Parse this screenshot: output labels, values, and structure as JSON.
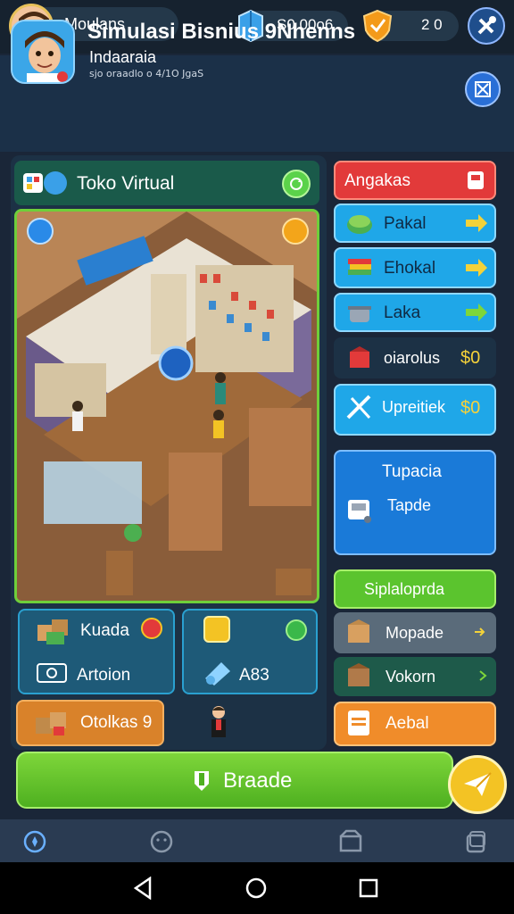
{
  "topbar": {
    "username": "Moulans",
    "coins": "S0 00o6",
    "gems": "2 0"
  },
  "header": {
    "title": "Simulasi Bisnius 9Nhenns",
    "subtitle": "Indaaraia",
    "meta": "sjo oraadlo o 4/1O JgaS"
  },
  "store": {
    "title": "Toko Virtual"
  },
  "tiles": {
    "kuada": "Kuada",
    "artoion": "Artoion",
    "a83": "A83",
    "otolkas": "Otolkas 9"
  },
  "menu": {
    "angakas": "Angakas",
    "pakal": "Pakal",
    "ehokal": "Ehokal",
    "laka": "Laka",
    "oiarolus": "oiarolus",
    "oiarolus_value": "$0",
    "upreitiek": "Upreitiek",
    "upreitiek_value": "$0",
    "tupacia": "Tupacia",
    "tapde": "Tapde",
    "siplaloprda": "Siplaloprda",
    "mopade": "Mopade",
    "vokorn": "Vokorn",
    "aebal": "Aebal"
  },
  "buttons": {
    "main": "Braade"
  },
  "colors": {
    "accent_green": "#6fcf3a",
    "menu_blue": "#1fa7e8",
    "menu_red": "#e23a3a",
    "menu_orange": "#f08c2a"
  }
}
